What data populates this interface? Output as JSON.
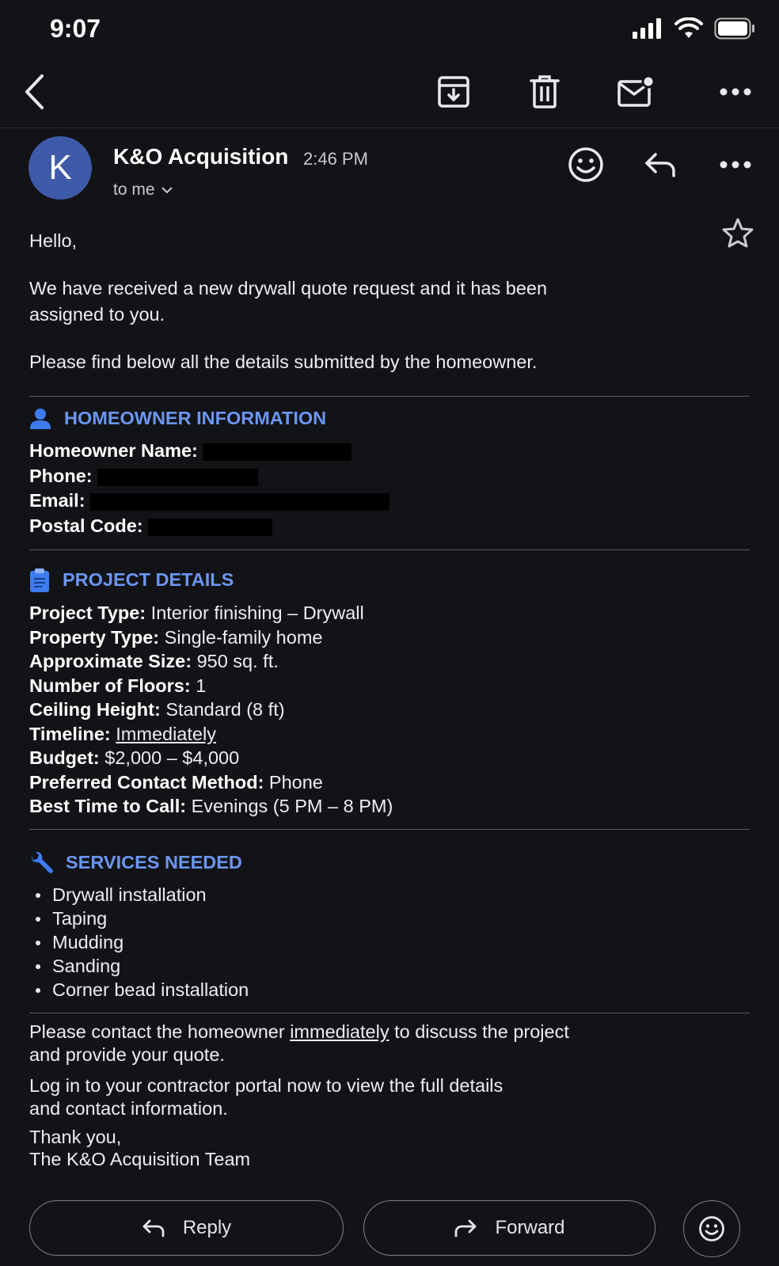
{
  "status_bar": {
    "time": "9:07"
  },
  "email": {
    "sender_initial": "K",
    "sender": "K&O Acquisition",
    "time": "2:46 PM",
    "recipient": "to me"
  },
  "body": {
    "greeting": "Hello,",
    "intro_line1": "We have received a new drywall quote request and it has been",
    "intro_line2": "assigned to you.",
    "intro2": "Please find below all the details submitted by the homeowner.",
    "homeowner": {
      "title": "HOMEOWNER INFORMATION",
      "name_label": "Homeowner Name:",
      "phone_label": "Phone:",
      "email_label": "Email:",
      "postal_label": "Postal Code:"
    },
    "project": {
      "title": "PROJECT DETAILS",
      "type_label": "Project Type:",
      "type_value": "Interior finishing – Drywall",
      "property_label": "Property Type:",
      "property_value": "Single-family home",
      "size_label": "Approximate Size:",
      "size_value": "950 sq. ft.",
      "floors_label": "Number of Floors:",
      "floors_value": "1",
      "ceiling_label": "Ceiling Height:",
      "ceiling_value": "Standard (8 ft)",
      "timeline_label": "Timeline:",
      "timeline_value": "Immediately",
      "budget_label": "Budget:",
      "budget_value": "$2,000 – $4,000",
      "contact_label": "Preferred Contact Method:",
      "contact_value": "Phone",
      "call_label": "Best Time to Call:",
      "call_value": "Evenings (5 PM – 8 PM)"
    },
    "services": {
      "title": "SERVICES NEEDED",
      "items": [
        "Drywall installation",
        "Taping",
        "Mudding",
        "Sanding",
        "Corner bead installation"
      ]
    },
    "closing1_pre": "Please contact the homeowner",
    "closing1_link": "immediately",
    "closing1_post": "to discuss the project",
    "closing1_line2": "and provide your quote.",
    "closing2_line1": "Log in to your contractor portal now to view the full details",
    "closing2_line2": "and contact information.",
    "signoff1": "Thank you,",
    "signoff2": "The K&O Acquisition Team"
  },
  "actions": {
    "reply": "Reply",
    "forward": "Forward"
  },
  "colors": {
    "background": "#121316",
    "accent": "#6b96f2",
    "avatar": "#3f5aa8"
  }
}
